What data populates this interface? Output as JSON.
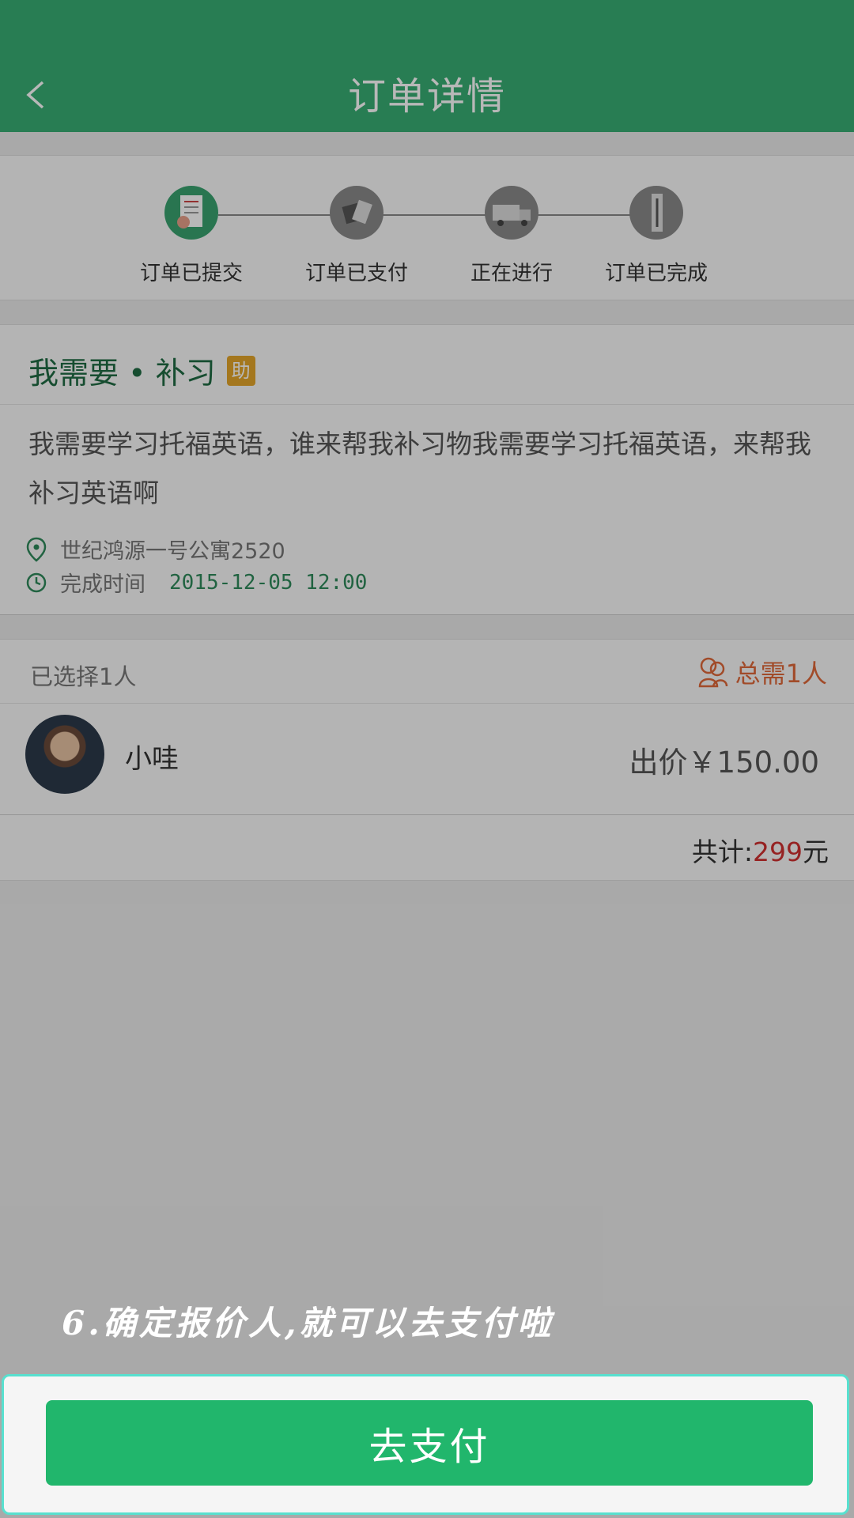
{
  "header": {
    "title": "订单详情",
    "back_icon": "chevron-left-icon"
  },
  "progress": {
    "steps": [
      {
        "label": "订单已提交",
        "icon": "order-submitted-icon",
        "active": true
      },
      {
        "label": "订单已支付",
        "icon": "order-paid-icon",
        "active": false
      },
      {
        "label": "正在进行",
        "icon": "truck-icon",
        "active": false
      },
      {
        "label": "订单已完成",
        "icon": "order-complete-icon",
        "active": false
      }
    ]
  },
  "order": {
    "title": "我需要 • 补习",
    "tag": "助",
    "description": "我需要学习托福英语，谁来帮我补习物我需要学习托福英语，来帮我补习英语啊",
    "address": "世纪鸿源一号公寓2520",
    "time_label": "完成时间",
    "time_value": "2015-12-05 12:00"
  },
  "selection": {
    "selected_count": "已选择1人",
    "total_needed": "总需1人",
    "bidder": {
      "name": "小哇",
      "price": "出价￥150.00"
    },
    "sum_label": "共计:",
    "sum_value": "299",
    "sum_unit": "元"
  },
  "hint": "6.确定报价人,就可以去支付啦",
  "pay_button": {
    "label": "去支付"
  },
  "colors": {
    "header": "#38ad73",
    "accent": "#21b66c",
    "highlight": "#58e0cf",
    "price_red": "#d03030",
    "orange": "#e0683a"
  }
}
